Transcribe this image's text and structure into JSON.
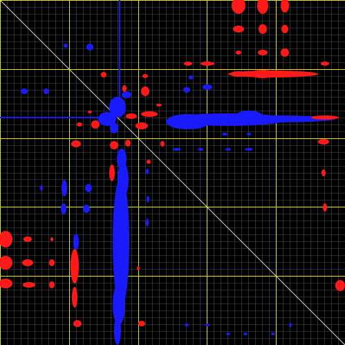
{
  "spectrum_view": {
    "background_color": "#000000",
    "colors": {
      "grid_minor": "#8f8f8f",
      "grid_major": "#e8e800",
      "diagonal": "#d8d8d8",
      "positive_peaks": "#1a1aff",
      "negative_peaks": "#ff1a1a"
    },
    "grid_minor_count": 50,
    "grid_major_count": 5,
    "diagonal_shown": true
  }
}
